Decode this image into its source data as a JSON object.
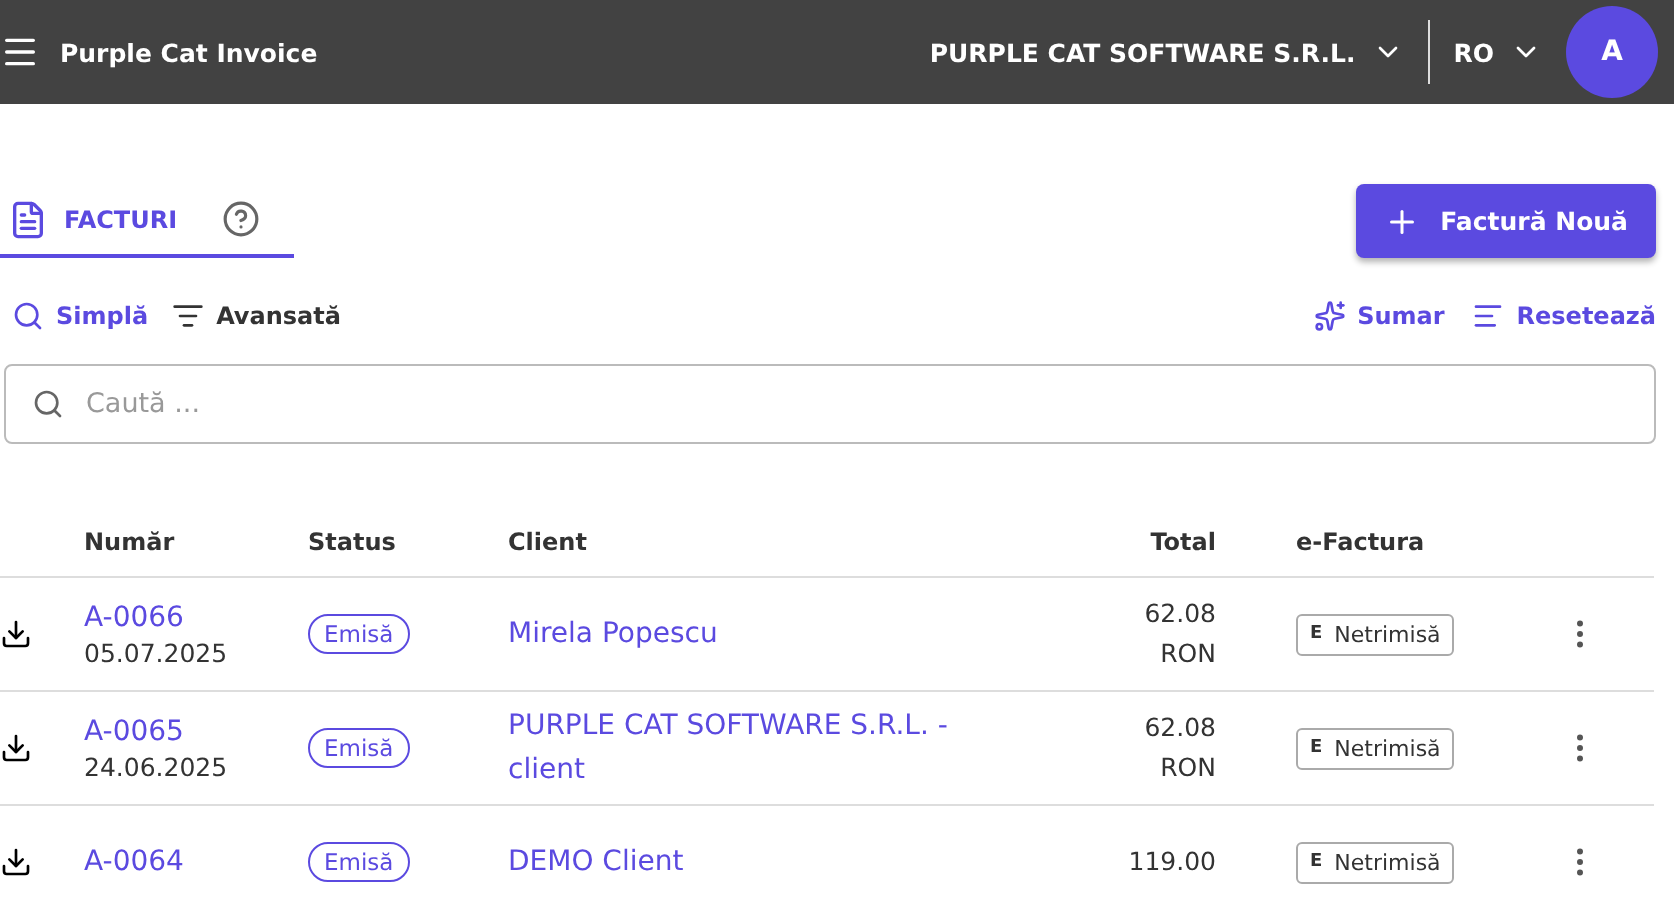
{
  "app_bar": {
    "title": "Purple Cat Invoice",
    "company": "PURPLE CAT SOFTWARE S.R.L.",
    "language": "RO",
    "avatar": "A"
  },
  "tabs": [
    {
      "label": "FACTURI",
      "selected": true
    }
  ],
  "new_button": "Factură Nouă",
  "search_modes": [
    {
      "label": "Simplă",
      "selected": true,
      "kind": "simple"
    },
    {
      "label": "Avansată",
      "selected": false,
      "kind": "advanced"
    }
  ],
  "actions": [
    {
      "label": "Sumar",
      "kind": "summary"
    },
    {
      "label": "Resetează",
      "kind": "reset"
    }
  ],
  "search": {
    "placeholder": "Caută ..."
  },
  "table": {
    "columns": [
      "Număr",
      "Status",
      "Client",
      "Total",
      "e-Factura"
    ],
    "rows": [
      {
        "number": "A-0066",
        "date": "05.07.2025",
        "status": "Emisă",
        "client": "Mirela Popescu",
        "amount": "62.08",
        "currency": "RON",
        "efactura_mark": "E",
        "efactura": "Netrimisă"
      },
      {
        "number": "A-0065",
        "date": "24.06.2025",
        "status": "Emisă",
        "client": "PURPLE CAT SOFTWARE S.R.L. - client",
        "amount": "62.08",
        "currency": "RON",
        "efactura_mark": "E",
        "efactura": "Netrimisă"
      },
      {
        "number": "A-0064",
        "status": "Emisă",
        "client": "DEMO Client",
        "amount": "119.00",
        "efactura_mark": "E",
        "efactura": "Netrimisă"
      }
    ]
  }
}
